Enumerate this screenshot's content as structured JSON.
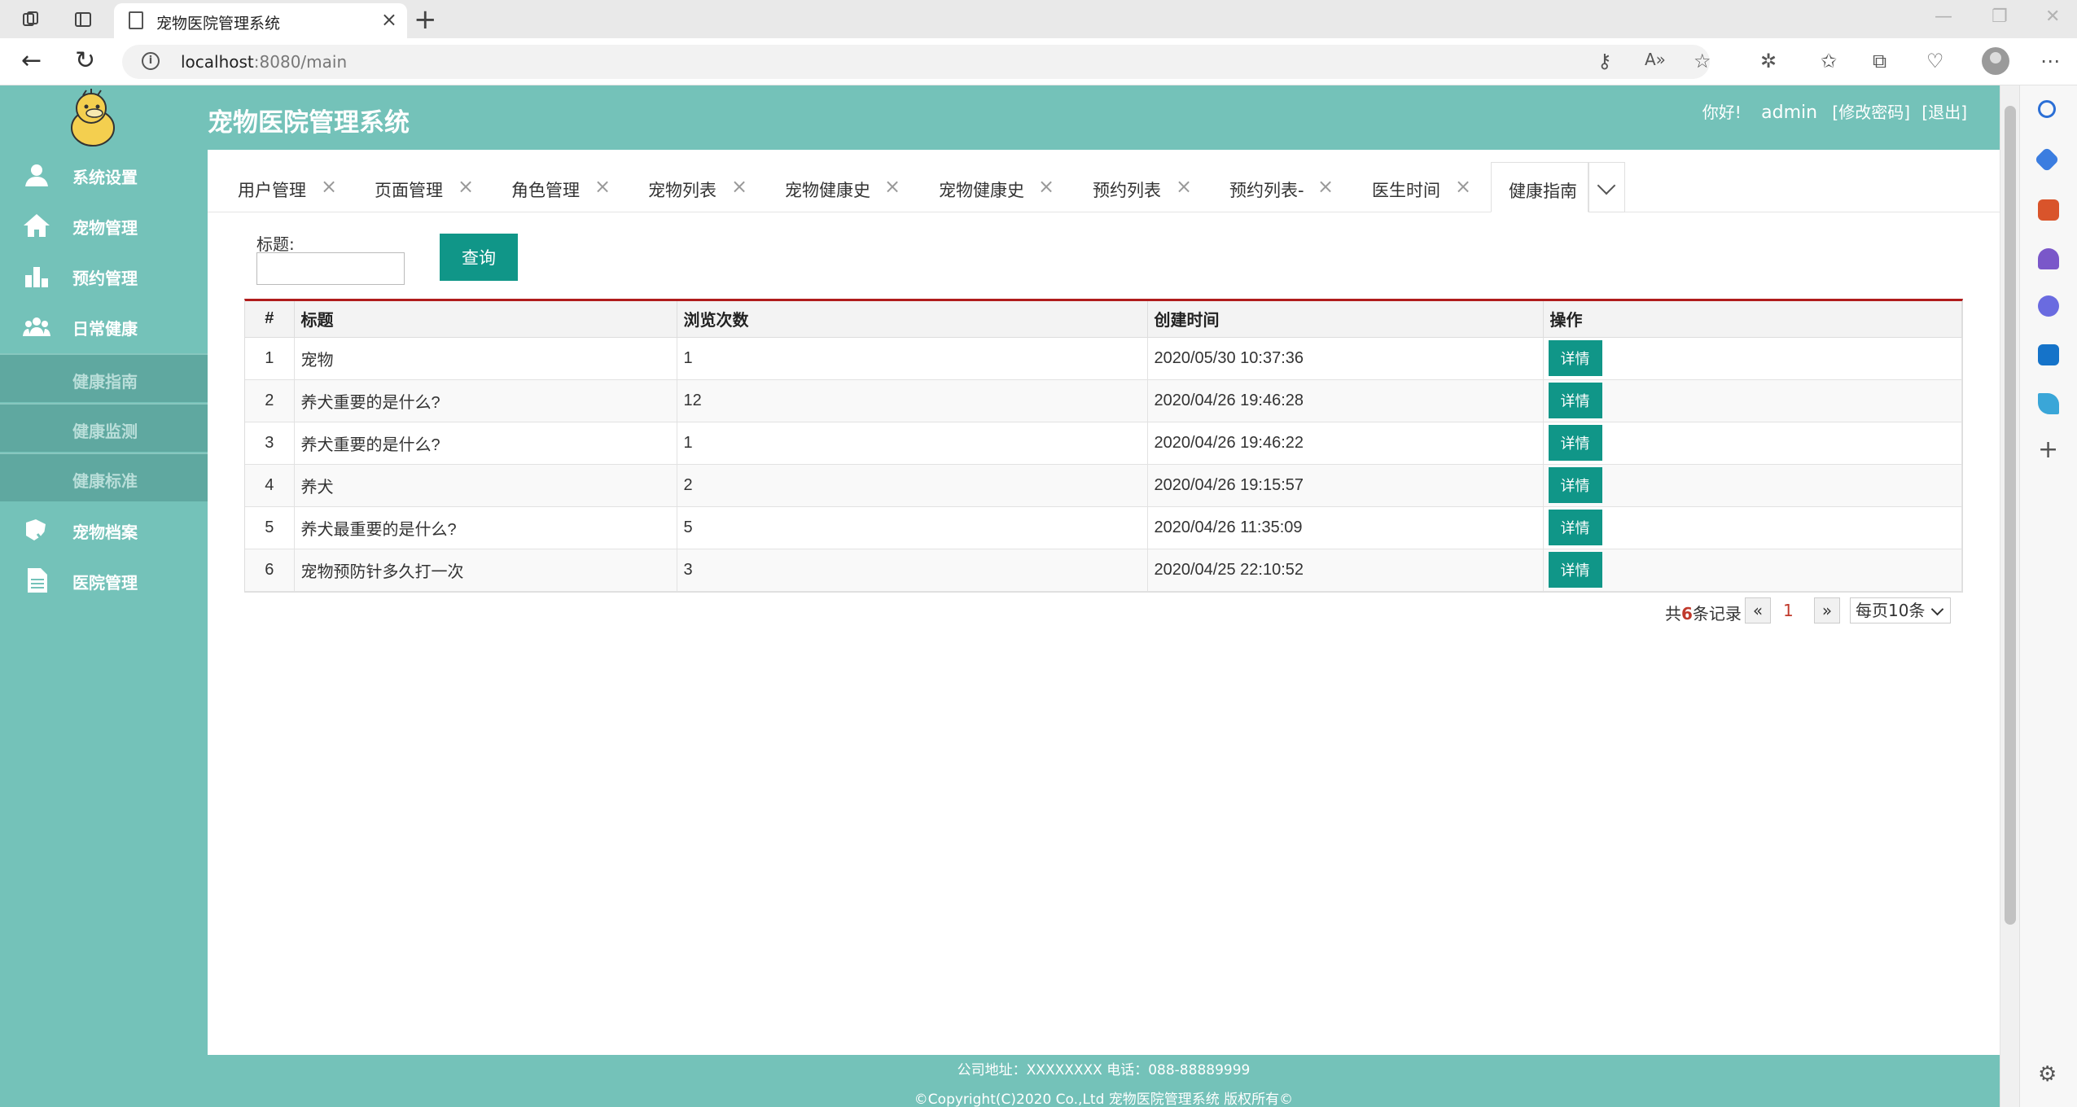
{
  "browser": {
    "tab_title": "宠物医院管理系统",
    "url_host": "localhost",
    "url_rest": ":8080/main"
  },
  "app": {
    "title": "宠物医院管理系统",
    "greeting": "你好!",
    "username": "admin",
    "change_password": "[修改密码]",
    "logout": "[退出]"
  },
  "sidebar": {
    "items": [
      {
        "label": "系统设置",
        "icon": "user-icon"
      },
      {
        "label": "宠物管理",
        "icon": "home-icon"
      },
      {
        "label": "预约管理",
        "icon": "bar-chart-icon"
      },
      {
        "label": "日常健康",
        "icon": "group-icon"
      }
    ],
    "subitems": [
      {
        "label": "健康指南"
      },
      {
        "label": "健康监测"
      },
      {
        "label": "健康标准"
      }
    ],
    "items_after": [
      {
        "label": "宠物档案",
        "icon": "pet-check-icon"
      },
      {
        "label": "医院管理",
        "icon": "document-icon"
      }
    ]
  },
  "tabs": [
    {
      "label": "用户管理"
    },
    {
      "label": "页面管理"
    },
    {
      "label": "角色管理"
    },
    {
      "label": "宠物列表"
    },
    {
      "label": "宠物健康史"
    },
    {
      "label": "宠物健康史"
    },
    {
      "label": "预约列表"
    },
    {
      "label": "预约列表-"
    },
    {
      "label": "医生时间"
    },
    {
      "label": "健康指南"
    }
  ],
  "search": {
    "label": "标题:",
    "value": "",
    "button": "查询"
  },
  "table": {
    "headers": [
      "#",
      "标题",
      "浏览次数",
      "创建时间",
      "操作"
    ],
    "rows": [
      {
        "no": "1",
        "title": "宠物",
        "views": "1",
        "created": "2020/05/30 10:37:36",
        "action": "详情"
      },
      {
        "no": "2",
        "title": "养犬重要的是什么?",
        "views": "12",
        "created": "2020/04/26 19:46:28",
        "action": "详情"
      },
      {
        "no": "3",
        "title": "养犬重要的是什么?",
        "views": "1",
        "created": "2020/04/26 19:46:22",
        "action": "详情"
      },
      {
        "no": "4",
        "title": "养犬",
        "views": "2",
        "created": "2020/04/26 19:15:57",
        "action": "详情"
      },
      {
        "no": "5",
        "title": "养犬最重要的是什么?",
        "views": "5",
        "created": "2020/04/26 11:35:09",
        "action": "详情"
      },
      {
        "no": "6",
        "title": "宠物预防针多久打一次",
        "views": "3",
        "created": "2020/04/25 22:10:52",
        "action": "详情"
      }
    ]
  },
  "pager": {
    "total_prefix": "共",
    "total_count": "6",
    "total_suffix": "条记录",
    "prev": "«",
    "current": "1",
    "next": "»",
    "page_size": "每页10条"
  },
  "footer": {
    "line1": "公司地址：XXXXXXXX 电话：088-88889999",
    "line2": "©Copyright(C)2020 Co.,Ltd 宠物医院管理系统 版权所有©"
  },
  "colors": {
    "theme": "#74c2b9",
    "button": "#109688",
    "grid_top_border": "#b01c1c"
  }
}
